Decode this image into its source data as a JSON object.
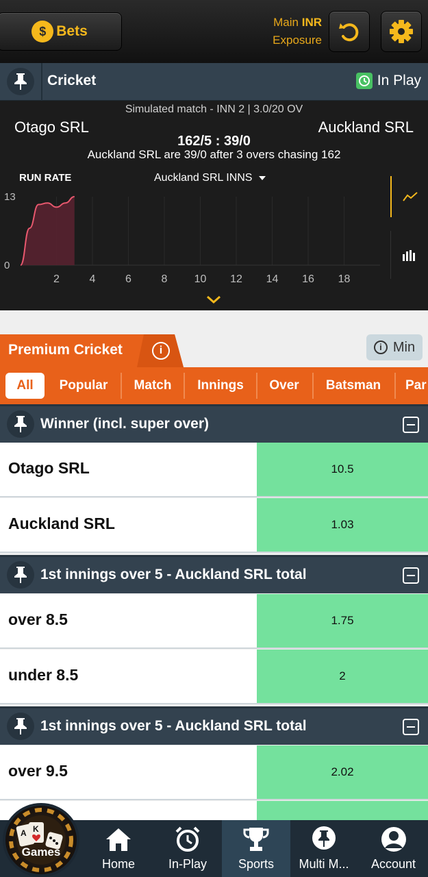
{
  "header": {
    "bets_label": "Bets",
    "wallet_main": "Main",
    "wallet_currency": "INR",
    "wallet_exposure": "Exposure"
  },
  "event": {
    "sport": "Cricket",
    "live_label": "In Play",
    "sim_line": "Simulated match - INN 2 | 3.0/20 OV",
    "team_a": "Otago SRL",
    "team_b": "Auckland SRL",
    "score": "162/5  :  39/0",
    "status": "Auckland SRL are 39/0 after 3 overs chasing 162"
  },
  "chart_data": {
    "type": "area",
    "title": "RUN RATE",
    "selector": "Auckland SRL INNS",
    "xlabel": "",
    "ylabel": "",
    "y_tick_labels": [
      "0",
      "13"
    ],
    "x_tick_labels": [
      "2",
      "4",
      "6",
      "8",
      "10",
      "12",
      "14",
      "16",
      "18"
    ],
    "xlim": [
      0,
      20
    ],
    "ylim": [
      0,
      13
    ],
    "x": [
      0,
      0.5,
      1,
      1.5,
      2,
      2.5,
      3
    ],
    "y": [
      0,
      7,
      11.5,
      11.8,
      11.0,
      11.8,
      13.0
    ],
    "grid": true,
    "color": "#e8586e"
  },
  "premium": {
    "title": "Premium Cricket",
    "info_glyph": "i",
    "min_label": "Min",
    "filters": [
      "All",
      "Popular",
      "Match",
      "Innings",
      "Over",
      "Batsman",
      "Par"
    ]
  },
  "markets": [
    {
      "title": "Winner (incl. super over)",
      "rows": [
        {
          "label": "Otago SRL",
          "odds": "10.5"
        },
        {
          "label": "Auckland SRL",
          "odds": "1.03"
        }
      ]
    },
    {
      "title": "1st innings over 5 - Auckland SRL total",
      "rows": [
        {
          "label": "over 8.5",
          "odds": "1.75"
        },
        {
          "label": "under 8.5",
          "odds": "2"
        }
      ]
    },
    {
      "title": "1st innings over 5 - Auckland SRL total",
      "rows": [
        {
          "label": "over 9.5",
          "odds": "2.02"
        }
      ]
    }
  ],
  "nav": {
    "games_label": "Games",
    "items": [
      "Home",
      "In-Play",
      "Sports",
      "Multi M...",
      "Account"
    ],
    "active": "Sports"
  },
  "colors": {
    "accent": "#e8611a",
    "gold": "#f5b81c",
    "header_slate": "#33424f",
    "odds_green": "#74e19d",
    "live_green": "#48c163"
  }
}
